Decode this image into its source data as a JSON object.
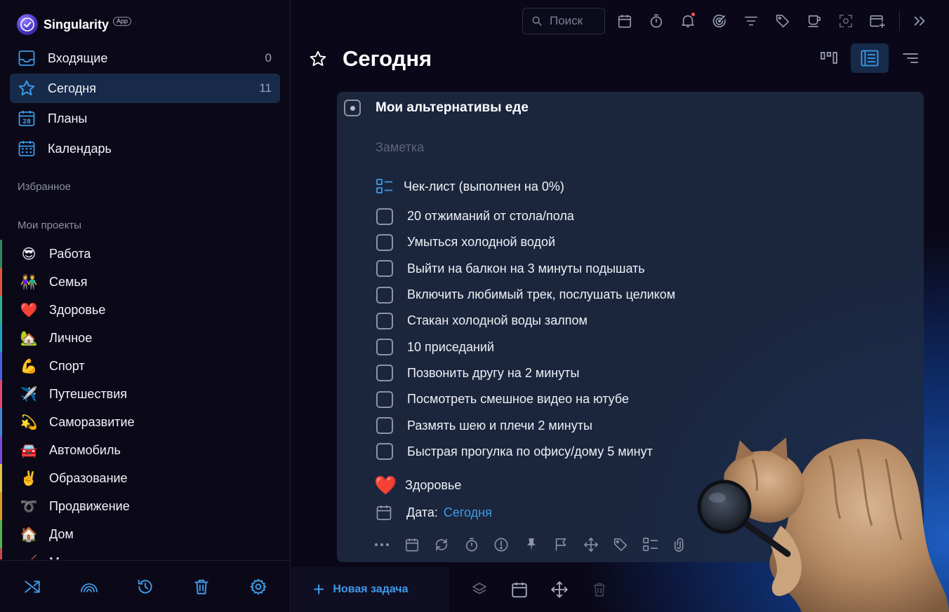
{
  "app": {
    "name": "Singularity",
    "badge": "App"
  },
  "nav": [
    {
      "label": "Входящие",
      "count": "0",
      "icon": "inbox-icon"
    },
    {
      "label": "Сегодня",
      "count": "11",
      "icon": "star-icon",
      "active": true
    },
    {
      "label": "Планы",
      "count": "",
      "icon": "calendar-28-icon",
      "day": "28"
    },
    {
      "label": "Календарь",
      "count": "",
      "icon": "calendar-grid-icon"
    }
  ],
  "sections": {
    "favorites": "Избранное",
    "projects": "Мои проекты"
  },
  "projects": [
    {
      "emoji": "😎",
      "label": "Работа",
      "color": "#2a8c5a"
    },
    {
      "emoji": "👫",
      "label": "Семья",
      "color": "#e0573a"
    },
    {
      "emoji": "❤️",
      "label": "Здоровье",
      "color": "#2ab38a"
    },
    {
      "emoji": "🏡",
      "label": "Личное",
      "color": "#20a6c4"
    },
    {
      "emoji": "💪",
      "label": "Спорт",
      "color": "#4c5fe0"
    },
    {
      "emoji": "✈️",
      "label": "Путешествия",
      "color": "#e0487a"
    },
    {
      "emoji": "💫",
      "label": "Саморазвитие",
      "color": "#3c8ad8"
    },
    {
      "emoji": "🚘",
      "label": "Автомобиль",
      "color": "#7a4cd8"
    },
    {
      "emoji": "✌️",
      "label": "Образование",
      "color": "#e0c24c"
    },
    {
      "emoji": "➰",
      "label": "Продвижение",
      "color": "#d89a2a"
    },
    {
      "emoji": "🏠",
      "label": "Дом",
      "color": "#4cb84c"
    },
    {
      "emoji": "🧹",
      "label": "М",
      "color": "#c84c4c"
    }
  ],
  "search": {
    "placeholder": "Поиск"
  },
  "page": {
    "title": "Сегодня"
  },
  "task": {
    "title": "Мои альтернативы еде",
    "note_placeholder": "Заметка",
    "checklist_title": "Чек-лист (выполнен на 0%)",
    "checklist": [
      "20 отжиманий от стола/пола",
      "Умыться холодной водой",
      "Выйти на балкон на 3 минуты подышать",
      "Включить любимый трек, послушать целиком",
      "Стакан холодной воды залпом",
      "10 приседаний",
      "Позвонить другу на 2 минуты",
      "Посмотреть смешное видео на ютубе",
      "Размять шею и плечи 2 минуты",
      "Быстрая прогулка по офису/дому 5 минут"
    ],
    "project_emoji": "❤️",
    "project": "Здоровье",
    "date_label": "Дата:",
    "date_value": "Сегодня"
  },
  "bottom": {
    "new_task": "Новая задача"
  },
  "colors": {
    "accent": "#3d9be9",
    "active_bg": "#172a4a",
    "card_bg": "#1e2a42"
  }
}
